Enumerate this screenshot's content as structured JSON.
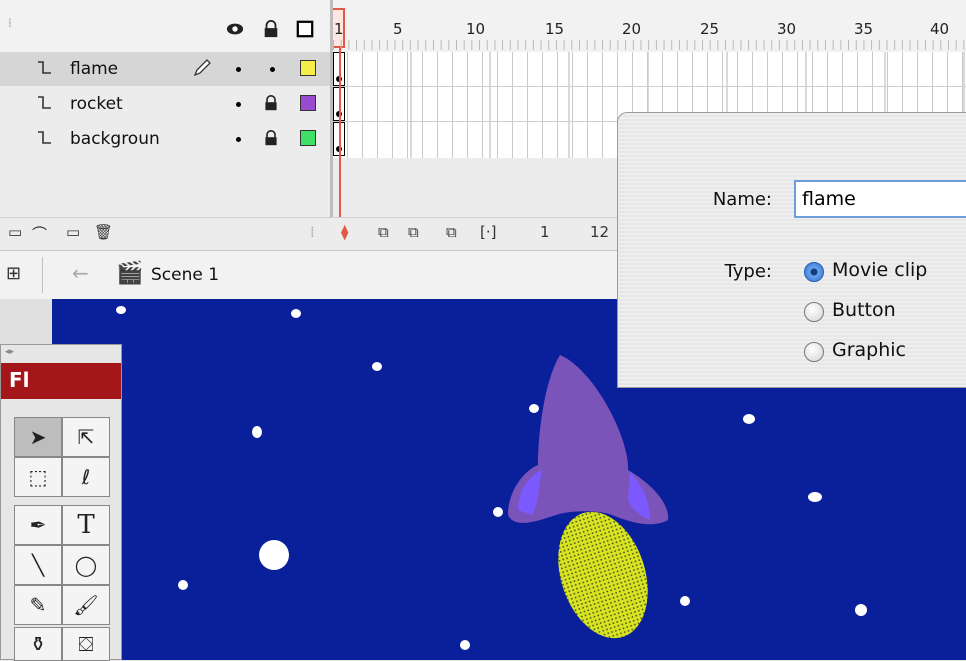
{
  "timeline": {
    "header_icons": [
      "eye-icon",
      "lock-icon",
      "outline-icon"
    ],
    "frame_numbers": [
      "1",
      "5",
      "10",
      "15",
      "20",
      "25",
      "30",
      "35",
      "40"
    ],
    "layers": [
      {
        "name": "flame",
        "color": "#f4ef48",
        "locked": false,
        "selected": true
      },
      {
        "name": "rocket",
        "color": "#9a4bd0",
        "locked": true,
        "selected": false
      },
      {
        "name": "backgroun",
        "color": "#3ee066",
        "locked": true,
        "selected": false
      }
    ],
    "bottom": {
      "current_frame": "1",
      "frame_rate": "12"
    }
  },
  "edit_bar": {
    "scene_label": "Scene 1"
  },
  "tools": {
    "title": "Fl"
  },
  "dialog": {
    "name_label": "Name:",
    "name_value": "flame",
    "type_label": "Type:",
    "types": [
      {
        "label": "Movie clip",
        "checked": true
      },
      {
        "label": "Button",
        "checked": false
      },
      {
        "label": "Graphic",
        "checked": false
      }
    ]
  },
  "colors": {
    "stage_background": "#0a1f9a",
    "rocket": "#7a54b8",
    "rocket_fins": "#7c59ff",
    "flame": "#d6e422"
  }
}
